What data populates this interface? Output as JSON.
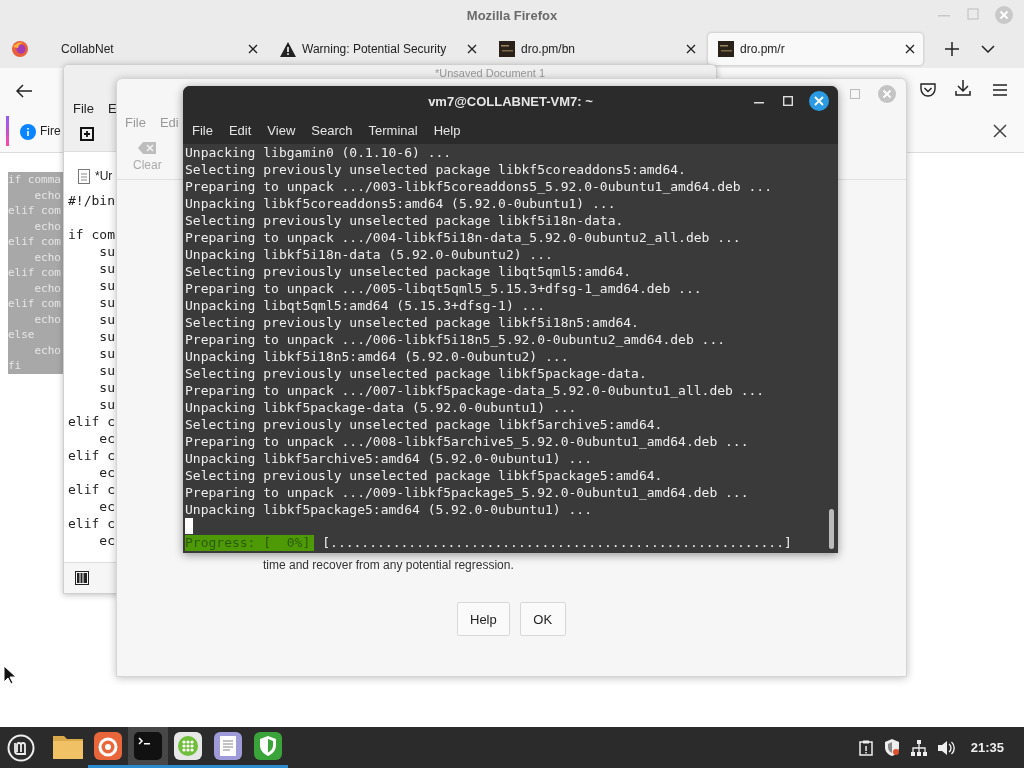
{
  "firefox": {
    "title": "Mozilla Firefox",
    "tabs": [
      {
        "label": "CollabNet",
        "kind": "plain",
        "selected": false
      },
      {
        "label": "Warning: Potential Security",
        "kind": "warning",
        "selected": false
      },
      {
        "label": "dro.pm/bn",
        "kind": "site",
        "selected": false
      },
      {
        "label": "dro.pm/r",
        "kind": "site",
        "selected": true
      }
    ],
    "notification": "Fire",
    "page_code": [
      "if comma",
      "    echo",
      "elif com",
      "    echo",
      "elif com",
      "    echo",
      "elif com",
      "    echo",
      "elif com",
      "    echo",
      "else",
      "    echo",
      "fi"
    ]
  },
  "editor": {
    "title": "*Unsaved Document 1",
    "menu": [
      "File",
      "E"
    ],
    "tab": "*Ur",
    "shebang": "#!/bin",
    "lines": [
      "if com",
      "    su",
      "    su",
      "    su",
      "    su",
      "    su",
      "    su",
      "    su",
      "    su",
      "    su",
      "    su",
      "elif c",
      "    ec",
      "elif c",
      "    ec",
      "elif c",
      "    ec",
      "elif c",
      "    ec"
    ]
  },
  "dialog": {
    "menu": [
      "File",
      "Edi"
    ],
    "toolbar": [
      "Clear"
    ],
    "message": "time and recover from any potential regression.",
    "buttons": [
      "Help",
      "OK"
    ]
  },
  "terminal": {
    "title": "vm7@COLLABNET-VM7: ~",
    "menu": [
      "File",
      "Edit",
      "View",
      "Search",
      "Terminal",
      "Help"
    ],
    "lines": [
      "Unpacking libgamin0 (0.1.10-6) ...",
      "Selecting previously unselected package libkf5coreaddons5:amd64.",
      "Preparing to unpack .../003-libkf5coreaddons5_5.92.0-0ubuntu1_amd64.deb ...",
      "Unpacking libkf5coreaddons5:amd64 (5.92.0-0ubuntu1) ...",
      "Selecting previously unselected package libkf5i18n-data.",
      "Preparing to unpack .../004-libkf5i18n-data_5.92.0-0ubuntu2_all.deb ...",
      "Unpacking libkf5i18n-data (5.92.0-0ubuntu2) ...",
      "Selecting previously unselected package libqt5qml5:amd64.",
      "Preparing to unpack .../005-libqt5qml5_5.15.3+dfsg-1_amd64.deb ...",
      "Unpacking libqt5qml5:amd64 (5.15.3+dfsg-1) ...",
      "Selecting previously unselected package libkf5i18n5:amd64.",
      "Preparing to unpack .../006-libkf5i18n5_5.92.0-0ubuntu2_amd64.deb ...",
      "Unpacking libkf5i18n5:amd64 (5.92.0-0ubuntu2) ...",
      "Selecting previously unselected package libkf5package-data.",
      "Preparing to unpack .../007-libkf5package-data_5.92.0-0ubuntu1_all.deb ...",
      "Unpacking libkf5package-data (5.92.0-0ubuntu1) ...",
      "Selecting previously unselected package libkf5archive5:amd64.",
      "Preparing to unpack .../008-libkf5archive5_5.92.0-0ubuntu1_amd64.deb ...",
      "Unpacking libkf5archive5:amd64 (5.92.0-0ubuntu1) ...",
      "Selecting previously unselected package libkf5package5:amd64.",
      "Preparing to unpack .../009-libkf5package5_5.92.0-0ubuntu1_amd64.deb ...",
      "Unpacking libkf5package5:amd64 (5.92.0-0ubuntu1) ..."
    ],
    "progress": {
      "label": "Progress: [  0%]",
      "bar": "[..........................................................]"
    }
  },
  "taskbar": {
    "apps": [
      {
        "kind": "folder",
        "running": false,
        "active": false
      },
      {
        "kind": "firefox",
        "running": true,
        "active": false
      },
      {
        "kind": "terminal",
        "running": true,
        "active": true
      },
      {
        "kind": "apps",
        "running": true,
        "active": false
      },
      {
        "kind": "editor",
        "running": true,
        "active": false
      },
      {
        "kind": "shield",
        "running": true,
        "active": false
      }
    ],
    "clock": "21:35"
  }
}
